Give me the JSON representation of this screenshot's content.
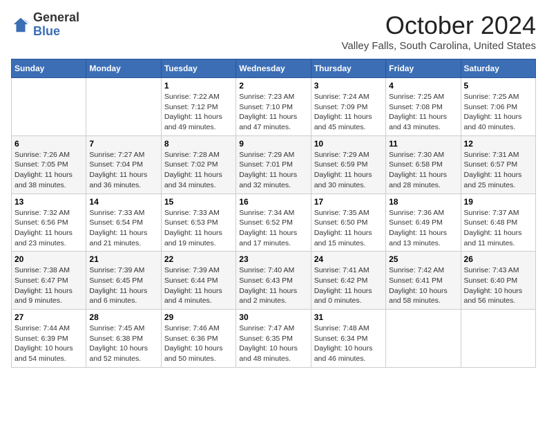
{
  "logo": {
    "general": "General",
    "blue": "Blue"
  },
  "header": {
    "month": "October 2024",
    "location": "Valley Falls, South Carolina, United States"
  },
  "weekdays": [
    "Sunday",
    "Monday",
    "Tuesday",
    "Wednesday",
    "Thursday",
    "Friday",
    "Saturday"
  ],
  "weeks": [
    [
      {
        "day": "",
        "info": ""
      },
      {
        "day": "",
        "info": ""
      },
      {
        "day": "1",
        "info": "Sunrise: 7:22 AM\nSunset: 7:12 PM\nDaylight: 11 hours and 49 minutes."
      },
      {
        "day": "2",
        "info": "Sunrise: 7:23 AM\nSunset: 7:10 PM\nDaylight: 11 hours and 47 minutes."
      },
      {
        "day": "3",
        "info": "Sunrise: 7:24 AM\nSunset: 7:09 PM\nDaylight: 11 hours and 45 minutes."
      },
      {
        "day": "4",
        "info": "Sunrise: 7:25 AM\nSunset: 7:08 PM\nDaylight: 11 hours and 43 minutes."
      },
      {
        "day": "5",
        "info": "Sunrise: 7:25 AM\nSunset: 7:06 PM\nDaylight: 11 hours and 40 minutes."
      }
    ],
    [
      {
        "day": "6",
        "info": "Sunrise: 7:26 AM\nSunset: 7:05 PM\nDaylight: 11 hours and 38 minutes."
      },
      {
        "day": "7",
        "info": "Sunrise: 7:27 AM\nSunset: 7:04 PM\nDaylight: 11 hours and 36 minutes."
      },
      {
        "day": "8",
        "info": "Sunrise: 7:28 AM\nSunset: 7:02 PM\nDaylight: 11 hours and 34 minutes."
      },
      {
        "day": "9",
        "info": "Sunrise: 7:29 AM\nSunset: 7:01 PM\nDaylight: 11 hours and 32 minutes."
      },
      {
        "day": "10",
        "info": "Sunrise: 7:29 AM\nSunset: 6:59 PM\nDaylight: 11 hours and 30 minutes."
      },
      {
        "day": "11",
        "info": "Sunrise: 7:30 AM\nSunset: 6:58 PM\nDaylight: 11 hours and 28 minutes."
      },
      {
        "day": "12",
        "info": "Sunrise: 7:31 AM\nSunset: 6:57 PM\nDaylight: 11 hours and 25 minutes."
      }
    ],
    [
      {
        "day": "13",
        "info": "Sunrise: 7:32 AM\nSunset: 6:56 PM\nDaylight: 11 hours and 23 minutes."
      },
      {
        "day": "14",
        "info": "Sunrise: 7:33 AM\nSunset: 6:54 PM\nDaylight: 11 hours and 21 minutes."
      },
      {
        "day": "15",
        "info": "Sunrise: 7:33 AM\nSunset: 6:53 PM\nDaylight: 11 hours and 19 minutes."
      },
      {
        "day": "16",
        "info": "Sunrise: 7:34 AM\nSunset: 6:52 PM\nDaylight: 11 hours and 17 minutes."
      },
      {
        "day": "17",
        "info": "Sunrise: 7:35 AM\nSunset: 6:50 PM\nDaylight: 11 hours and 15 minutes."
      },
      {
        "day": "18",
        "info": "Sunrise: 7:36 AM\nSunset: 6:49 PM\nDaylight: 11 hours and 13 minutes."
      },
      {
        "day": "19",
        "info": "Sunrise: 7:37 AM\nSunset: 6:48 PM\nDaylight: 11 hours and 11 minutes."
      }
    ],
    [
      {
        "day": "20",
        "info": "Sunrise: 7:38 AM\nSunset: 6:47 PM\nDaylight: 11 hours and 9 minutes."
      },
      {
        "day": "21",
        "info": "Sunrise: 7:39 AM\nSunset: 6:45 PM\nDaylight: 11 hours and 6 minutes."
      },
      {
        "day": "22",
        "info": "Sunrise: 7:39 AM\nSunset: 6:44 PM\nDaylight: 11 hours and 4 minutes."
      },
      {
        "day": "23",
        "info": "Sunrise: 7:40 AM\nSunset: 6:43 PM\nDaylight: 11 hours and 2 minutes."
      },
      {
        "day": "24",
        "info": "Sunrise: 7:41 AM\nSunset: 6:42 PM\nDaylight: 11 hours and 0 minutes."
      },
      {
        "day": "25",
        "info": "Sunrise: 7:42 AM\nSunset: 6:41 PM\nDaylight: 10 hours and 58 minutes."
      },
      {
        "day": "26",
        "info": "Sunrise: 7:43 AM\nSunset: 6:40 PM\nDaylight: 10 hours and 56 minutes."
      }
    ],
    [
      {
        "day": "27",
        "info": "Sunrise: 7:44 AM\nSunset: 6:39 PM\nDaylight: 10 hours and 54 minutes."
      },
      {
        "day": "28",
        "info": "Sunrise: 7:45 AM\nSunset: 6:38 PM\nDaylight: 10 hours and 52 minutes."
      },
      {
        "day": "29",
        "info": "Sunrise: 7:46 AM\nSunset: 6:36 PM\nDaylight: 10 hours and 50 minutes."
      },
      {
        "day": "30",
        "info": "Sunrise: 7:47 AM\nSunset: 6:35 PM\nDaylight: 10 hours and 48 minutes."
      },
      {
        "day": "31",
        "info": "Sunrise: 7:48 AM\nSunset: 6:34 PM\nDaylight: 10 hours and 46 minutes."
      },
      {
        "day": "",
        "info": ""
      },
      {
        "day": "",
        "info": ""
      }
    ]
  ]
}
